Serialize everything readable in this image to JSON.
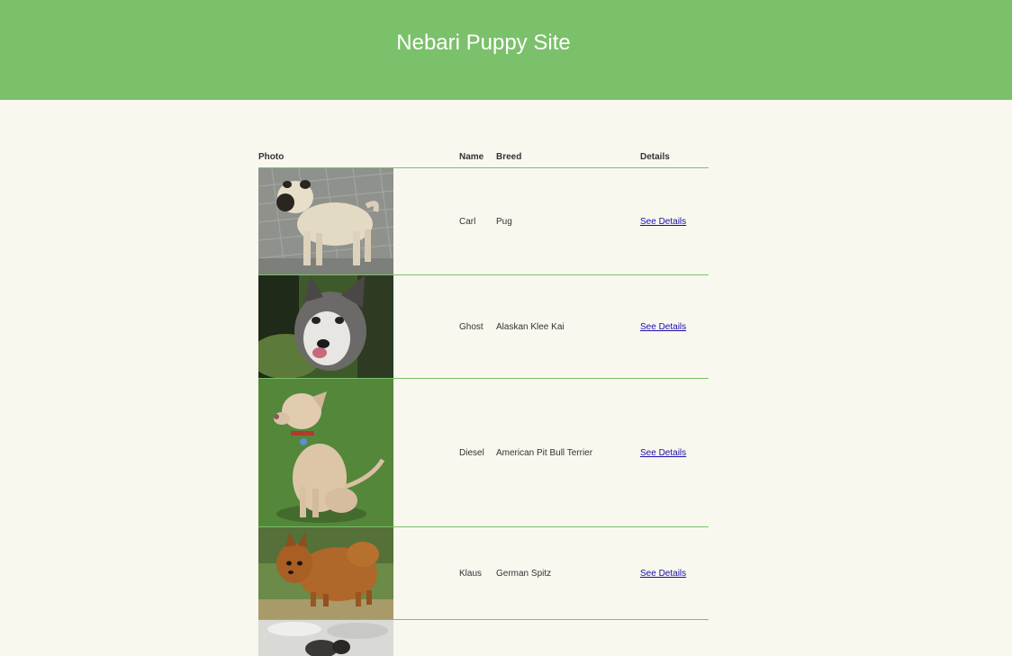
{
  "header": {
    "title": "Nebari Puppy Site"
  },
  "table": {
    "columns": [
      "Photo",
      "Name",
      "Breed",
      "Details"
    ],
    "rows": [
      {
        "photo": "pug-photo",
        "name": "Carl",
        "breed": "Pug",
        "details": "See Details"
      },
      {
        "photo": "husky-photo",
        "name": "Ghost",
        "breed": "Alaskan Klee Kai",
        "details": "See Details"
      },
      {
        "photo": "pitbull-photo",
        "name": "Diesel",
        "breed": "American Pit Bull Terrier",
        "details": "See Details"
      },
      {
        "photo": "spitz-photo",
        "name": "Klaus",
        "breed": "German Spitz",
        "details": "See Details"
      },
      {
        "photo": "dog-in-snow-photo",
        "name": "",
        "breed": "",
        "details": ""
      }
    ]
  },
  "colors": {
    "header_bg": "#7bc06a",
    "page_bg": "#f9f8ef",
    "link": "#1a0dab"
  }
}
